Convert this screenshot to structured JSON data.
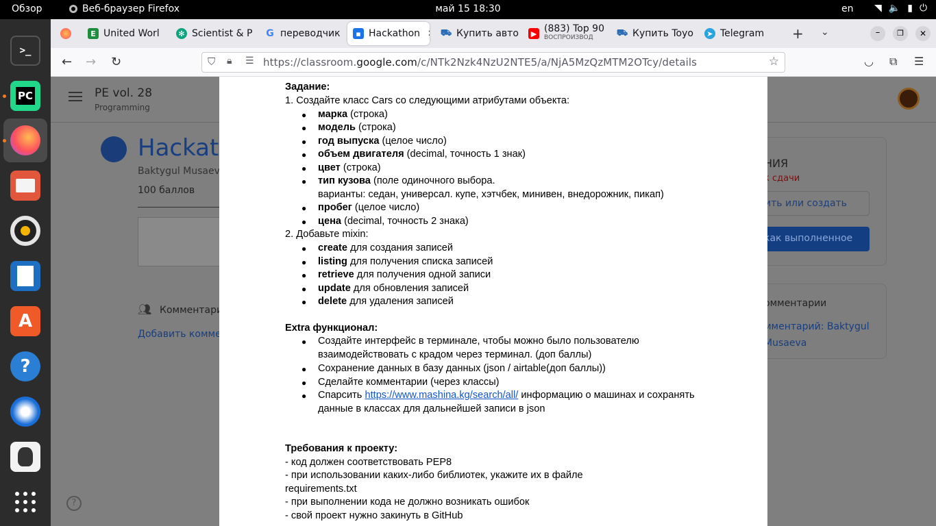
{
  "topbar": {
    "activities": "Обзор",
    "app_name": "Веб-браузер Firefox",
    "clock": "май 15  18:30",
    "lang": "en"
  },
  "tabs": [
    {
      "label": "United Worl",
      "icon": "document-icon",
      "color": "#1e8e3e"
    },
    {
      "label": "Scientist & P",
      "icon": "openai-icon",
      "color": "#10a37f"
    },
    {
      "label": "переводчик",
      "icon": "google-icon",
      "color": "#4285f4"
    },
    {
      "label": "Hackathon",
      "icon": "classroom-icon",
      "color": "#1a73e8"
    },
    {
      "label": "Купить авто",
      "icon": "car-icon",
      "color": "#2d6db5"
    },
    {
      "label": "(883) Top 90",
      "sub": "ВОСПРОИЗВОД",
      "icon": "youtube-icon",
      "color": "#ff0000"
    },
    {
      "label": "Купить Toyo",
      "icon": "car-icon",
      "color": "#2d6db5"
    },
    {
      "label": "Telegram",
      "icon": "telegram-icon",
      "color": "#2aa3df"
    }
  ],
  "url": {
    "prefix": "https://classroom.",
    "domain": "google.com",
    "path": "/c/NTk2Nzk4NzU2NTE5/a/NjA5MzQzMTM2OTcy/details"
  },
  "course": {
    "title": "PE vol. 28",
    "subtitle": "Programming"
  },
  "assignment": {
    "title": "Hackath",
    "author": "Baktygul Musaeva",
    "points": "100 баллов",
    "comments_label": "Комментари",
    "add_comment": "Добавить коммен"
  },
  "side_card": {
    "title": "НИЯ",
    "due": "к сдачи",
    "add_button": "ить или создать",
    "done_button": "как выполненное"
  },
  "private_comments": {
    "title": "омментарии",
    "link_line1": "мментарий: Baktygul",
    "link_line2": "Musaeva"
  },
  "document": {
    "task_heading": "Задание:",
    "step1": "1. Создайте класс Cars со следующими атрибутами объекта:",
    "attributes": [
      {
        "name": "марка",
        "desc": " (строка)"
      },
      {
        "name": "модель",
        "desc": " (строка)"
      },
      {
        "name": "год выпуска",
        "desc": " (целое число)"
      },
      {
        "name": "объем двигателя",
        "desc": " (decimal, точность 1 знак)"
      },
      {
        "name": "цвет",
        "desc": " (строка)"
      },
      {
        "name": "тип кузова",
        "desc": " (поле одиночного выбора."
      },
      {
        "name": "пробег",
        "desc": " (целое число)"
      },
      {
        "name": "цена",
        "desc": " (decimal, точность 2 знака)"
      }
    ],
    "body_variants": "варианты: седан, универсал. купе, хэтчбек, минивен, внедорожник, пикап)",
    "step2": "2. Добавьте mixin:",
    "mixins": [
      {
        "name": "create",
        "desc": " для создания записей"
      },
      {
        "name": "listing",
        "desc": " для получения списка записей"
      },
      {
        "name": "retrieve",
        "desc": " для получения одной записи"
      },
      {
        "name": "update",
        "desc": " для обновления записей"
      },
      {
        "name": "delete",
        "desc": " для удаления записей"
      }
    ],
    "extra_heading": "Extra функционал:",
    "extra": {
      "e1_line1": "Создайте интерфейс в терминале, чтобы можно было пользователю",
      "e1_line2": "взаимодействовать с крадом через терминал. (доп баллы)",
      "e2": "Сохранение данных в базу данных (json / airtable(доп баллы))",
      "e3": "Сделайте комментарии (через классы)",
      "e4_pre": "Спарсить ",
      "e4_link": "https://www.mashina.kg/search/all/",
      "e4_post": " информацию о машинах и сохранять",
      "e4_line2": "данные в классах для дальнейшей записи в json"
    },
    "req_heading": "Требования к проекту:",
    "requirements": [
      "- код должен соответствовать PEP8",
      "- при использовании каких-либо библиотек, укажите их в файле",
      "requirements.txt",
      "- при выполнении кода не должно возникать ошибок",
      "- свой проект нужно закинуть в GitHub"
    ]
  }
}
